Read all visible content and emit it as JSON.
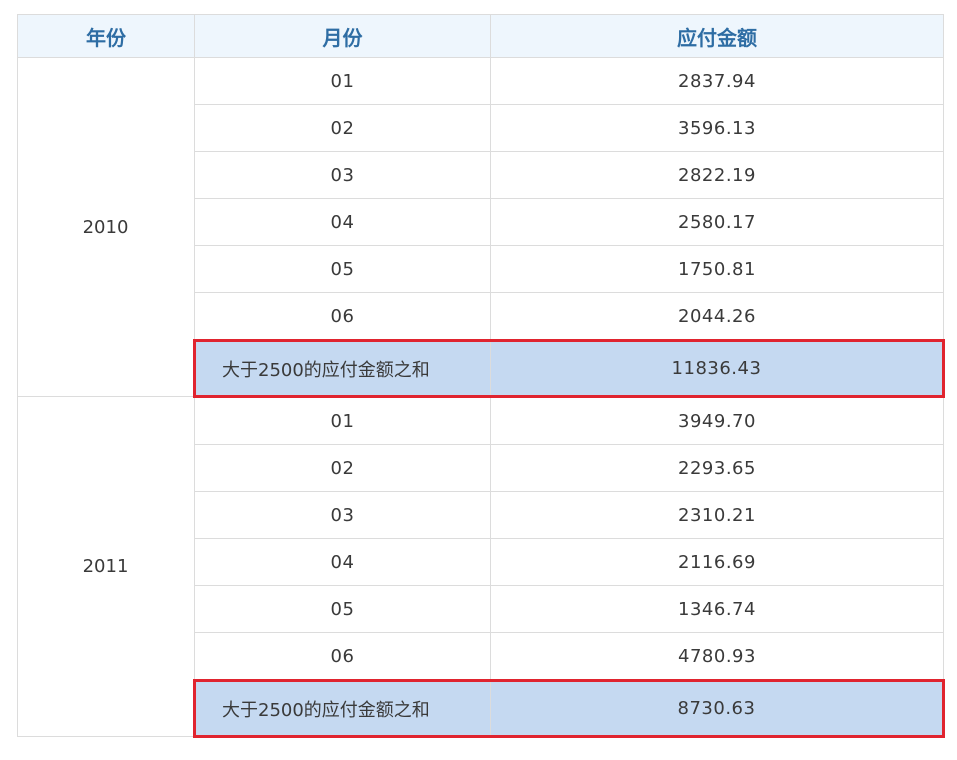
{
  "table": {
    "headers": [
      "年份",
      "月份",
      "应付金额"
    ],
    "groups": [
      {
        "year": "2010",
        "rows": [
          {
            "month": "01",
            "amount": "2837.94"
          },
          {
            "month": "02",
            "amount": "3596.13"
          },
          {
            "month": "03",
            "amount": "2822.19"
          },
          {
            "month": "04",
            "amount": "2580.17"
          },
          {
            "month": "05",
            "amount": "1750.81"
          },
          {
            "month": "06",
            "amount": "2044.26"
          }
        ],
        "sum_label": "大于2500的应付金额之和",
        "sum_value": "11836.43"
      },
      {
        "year": "2011",
        "rows": [
          {
            "month": "01",
            "amount": "3949.70"
          },
          {
            "month": "02",
            "amount": "2293.65"
          },
          {
            "month": "03",
            "amount": "2310.21"
          },
          {
            "month": "04",
            "amount": "2116.69"
          },
          {
            "month": "05",
            "amount": "1346.74"
          },
          {
            "month": "06",
            "amount": "4780.93"
          }
        ],
        "sum_label": "大于2500的应付金额之和",
        "sum_value": "8730.63"
      }
    ]
  },
  "colors": {
    "header_bg": "#eef6fd",
    "header_text": "#2e6da4",
    "sum_row_bg": "#c5d9f1",
    "highlight_border": "#e0242f",
    "grid_line": "#dcdcdc"
  }
}
